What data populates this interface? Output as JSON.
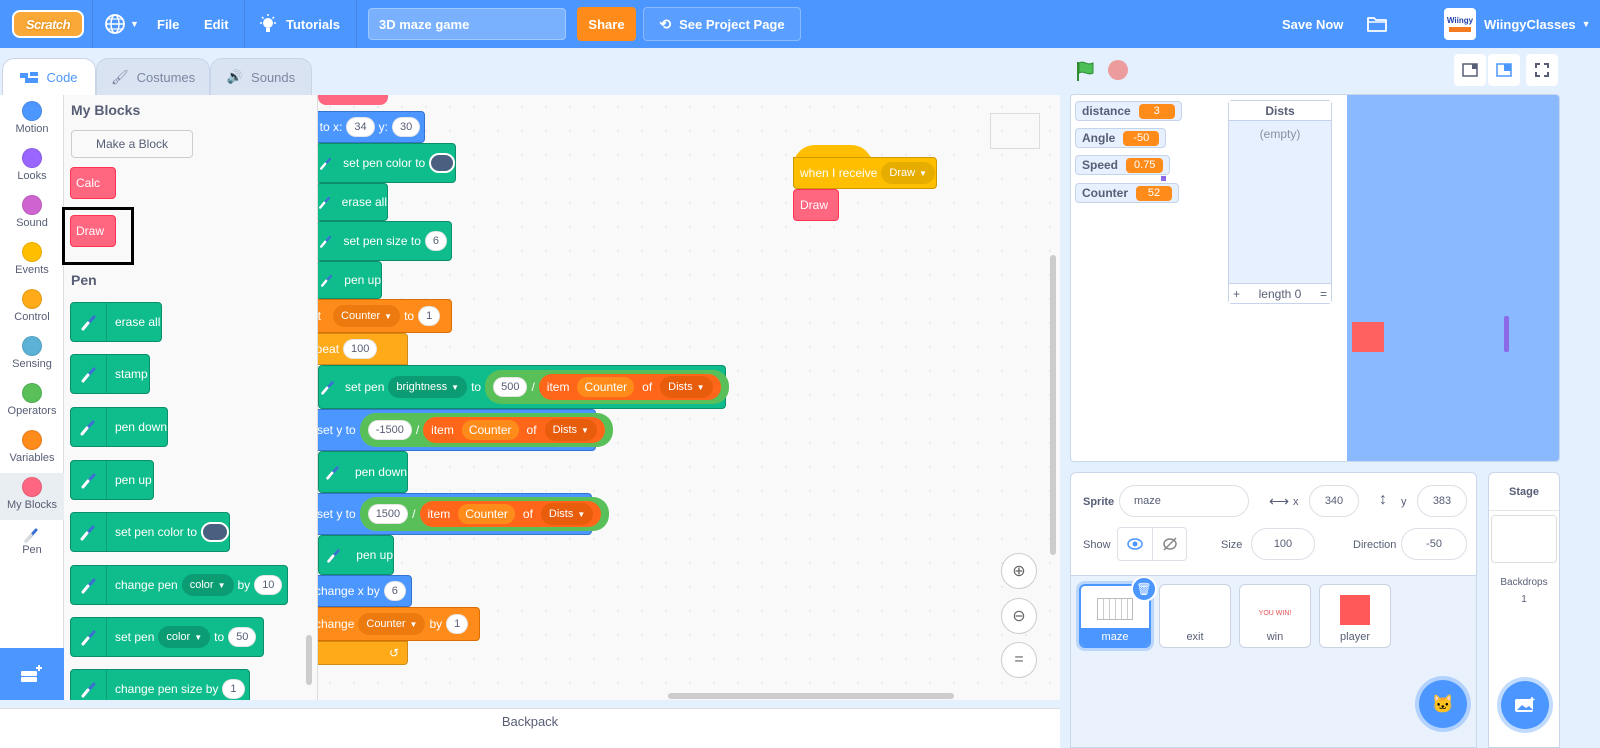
{
  "menubar": {
    "logo": "Scratch",
    "language_icon": "globe-icon",
    "file": "File",
    "edit": "Edit",
    "tutorials": "Tutorials",
    "project_title": "3D maze game",
    "share": "Share",
    "see_project_page": "See Project Page",
    "save_now": "Save Now",
    "username": "WiingyClasses",
    "avatar_text": "Wiingy"
  },
  "tabs": [
    {
      "label": "Code",
      "active": true
    },
    {
      "label": "Costumes",
      "active": false
    },
    {
      "label": "Sounds",
      "active": false
    }
  ],
  "categories": [
    {
      "label": "Motion",
      "color": "#4c97ff"
    },
    {
      "label": "Looks",
      "color": "#9966ff"
    },
    {
      "label": "Sound",
      "color": "#cf63cf"
    },
    {
      "label": "Events",
      "color": "#ffbf00"
    },
    {
      "label": "Control",
      "color": "#ffab19"
    },
    {
      "label": "Sensing",
      "color": "#5cb1d6"
    },
    {
      "label": "Operators",
      "color": "#59c059"
    },
    {
      "label": "Variables",
      "color": "#ff8c1a"
    },
    {
      "label": "My Blocks",
      "color": "#ff6680"
    },
    {
      "label": "Pen",
      "color": "#0fbd8c"
    }
  ],
  "palette": {
    "my_blocks_heading": "My Blocks",
    "make_block": "Make a Block",
    "custom_blocks": [
      "Calc",
      "Draw"
    ],
    "pen_heading": "Pen",
    "pen_blocks": {
      "erase_all": "erase all",
      "stamp": "stamp",
      "pen_down": "pen down",
      "pen_up": "pen up",
      "set_pen_color_to": "set pen color to",
      "change_pen": "change pen",
      "color": "color",
      "by": "by",
      "change_pen_value": "10",
      "set_pen": "set pen",
      "to": "to",
      "set_pen_value": "50",
      "change_pen_size_by": "change pen size by",
      "change_pen_size_value": "1"
    }
  },
  "script": {
    "goto_label": "go to x:",
    "goto_x": "34",
    "goto_y_label": "y:",
    "goto_y": "30",
    "set_pen_color_to": "set pen color to",
    "erase_all": "erase all",
    "set_pen_size_to": "set pen size to",
    "pen_size": "6",
    "pen_up": "pen up",
    "set": "set",
    "counter_var": "Counter",
    "to": "to",
    "set_value": "1",
    "repeat": "repeat",
    "repeat_count": "100",
    "set_pen": "set pen",
    "brightness": "brightness",
    "brightness_num": "500",
    "divide": "/",
    "item": "item",
    "of": "of",
    "list": "Dists",
    "set_y_to": "set y to",
    "set_y_num1": "-1500",
    "pen_down": "pen down",
    "set_y_num2": "1500",
    "change_x_by": "change x by",
    "change_x_value": "6",
    "change": "change",
    "by": "by",
    "change_value": "1",
    "when_i_receive": "when I receive",
    "receive_message": "Draw",
    "draw_call": "Draw"
  },
  "backpack": "Backpack",
  "stage": {
    "monitors": [
      {
        "name": "distance",
        "value": "3"
      },
      {
        "name": "Angle",
        "value": "-50"
      },
      {
        "name": "Speed",
        "value": "0.75"
      },
      {
        "name": "Counter",
        "value": "52"
      }
    ],
    "list_monitor": {
      "title": "Dists",
      "empty": "(empty)",
      "add": "+",
      "length": "length 0",
      "resize": "="
    }
  },
  "sprite_info": {
    "sprite_label": "Sprite",
    "sprite_name": "maze",
    "x_label": "x",
    "x": "340",
    "y_label": "y",
    "y": "383",
    "show_label": "Show",
    "size_label": "Size",
    "size": "100",
    "direction_label": "Direction",
    "direction": "-50"
  },
  "sprites": [
    {
      "name": "maze",
      "selected": true
    },
    {
      "name": "exit",
      "selected": false
    },
    {
      "name": "win",
      "selected": false,
      "thumb_text": "YOU WIN!"
    },
    {
      "name": "player",
      "selected": false
    }
  ],
  "stage_pane": {
    "title": "Stage",
    "backdrops_label": "Backdrops",
    "backdrops_count": "1"
  }
}
